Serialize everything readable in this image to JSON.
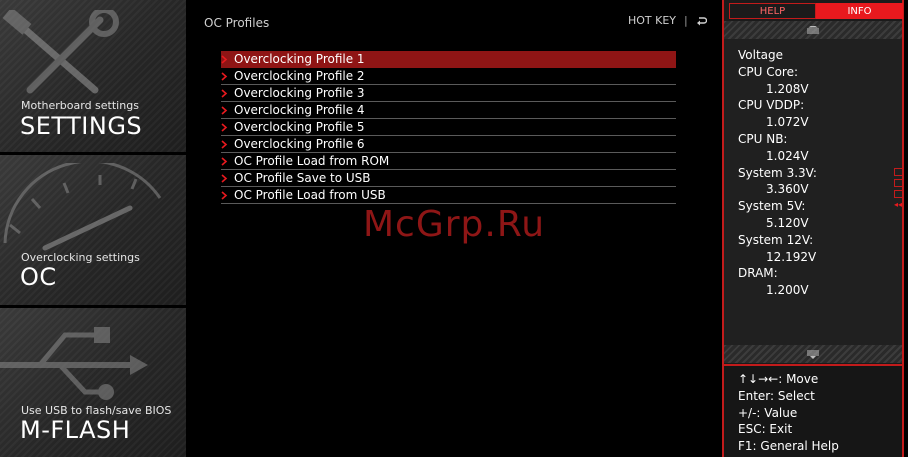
{
  "nav": [
    {
      "sub": "Motherboard settings",
      "title": "SETTINGS"
    },
    {
      "sub": "Overclocking settings",
      "title": "OC"
    },
    {
      "sub": "Use USB to flash/save BIOS",
      "title": "M-FLASH"
    }
  ],
  "page_title": "OC Profiles",
  "hotkey": {
    "label": "HOT KEY",
    "separator": "|"
  },
  "menu": [
    {
      "label": "Overclocking Profile 1"
    },
    {
      "label": "Overclocking Profile 2"
    },
    {
      "label": "Overclocking Profile 3"
    },
    {
      "label": "Overclocking Profile 4"
    },
    {
      "label": "Overclocking Profile 5"
    },
    {
      "label": "Overclocking Profile 6"
    },
    {
      "label": "OC Profile Load from ROM"
    },
    {
      "label": "OC Profile Save to USB"
    },
    {
      "label": "OC Profile Load from USB"
    }
  ],
  "selected_index": 0,
  "watermark": "McGrp.Ru",
  "tabs": {
    "help": "HELP",
    "info": "INFO",
    "active": "info"
  },
  "info": {
    "heading": "Voltage",
    "items": [
      {
        "label": "CPU Core:",
        "value": "1.208V"
      },
      {
        "label": "CPU VDDP:",
        "value": "1.072V"
      },
      {
        "label": "CPU NB:",
        "value": "1.024V"
      },
      {
        "label": "System 3.3V:",
        "value": "3.360V"
      },
      {
        "label": "System 5V:",
        "value": "5.120V"
      },
      {
        "label": "System 12V:",
        "value": "12.192V"
      },
      {
        "label": "DRAM:",
        "value": "1.200V"
      }
    ]
  },
  "help": [
    "↑↓→←: Move",
    "Enter: Select",
    "+/-: Value",
    "ESC: Exit",
    "F1: General Help"
  ],
  "colors": {
    "accent": "#e8191e",
    "selected_row": "#8f1515",
    "background": "#000000"
  }
}
